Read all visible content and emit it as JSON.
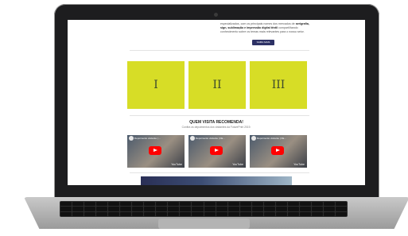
{
  "intro": {
    "faded_heading": "",
    "text_before": "especializados, com os principais nomes dos mercados de",
    "bold_text": "serigrafia, sign, sublimação e impressão digital têxtil",
    "text_after": "compartilhando conhecimento sobre os temas mais relevantes para o nosso setor.",
    "cta_label": "SAIBA MAIS"
  },
  "tiles": [
    "I",
    "II",
    "III"
  ],
  "recommend": {
    "title": "QUEM VISITA RECOMENDA!",
    "subtitle": "Confira os depoimentos dos visitantes da FuturePrint 2019."
  },
  "videos": [
    {
      "title": "Depoimento visitante | ...",
      "badge": "YouTube"
    },
    {
      "title": "Depoimento visitante | FE...",
      "badge": "YouTube"
    },
    {
      "title": "Depoimento visitante | FE...",
      "badge": "YouTube"
    }
  ],
  "colors": {
    "tile": "#d7dd26",
    "cta": "#2d3165",
    "play": "#ff0000"
  }
}
